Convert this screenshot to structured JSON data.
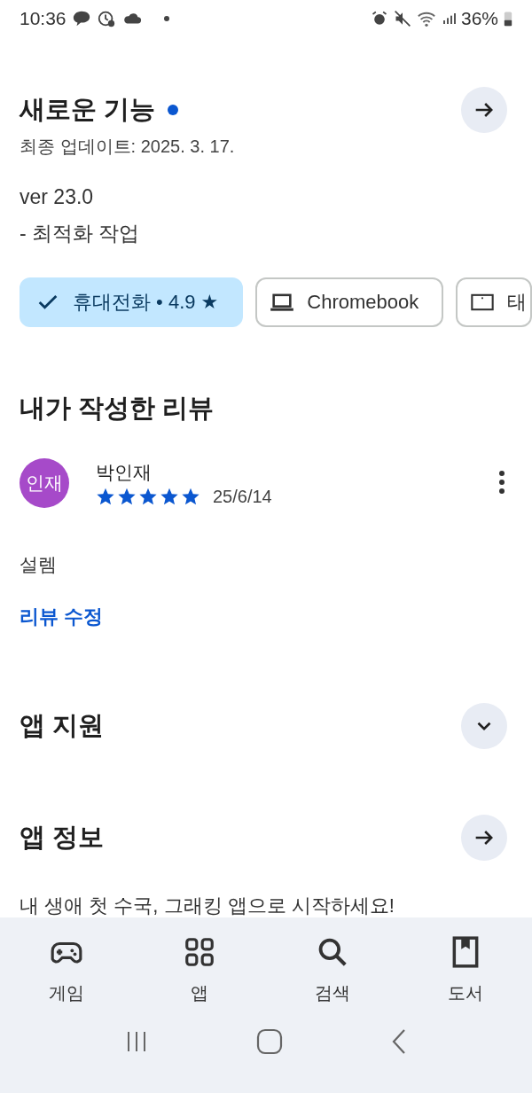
{
  "status_bar": {
    "time": "10:36",
    "battery": "36%"
  },
  "whats_new": {
    "title": "새로운 기능",
    "unread": true,
    "updated": "최종 업데이트: 2025. 3. 17.",
    "notes": [
      "ver 23.0",
      "- 최적화 작업"
    ]
  },
  "device_chips": [
    {
      "label": "휴대전화 • 4.9 ★",
      "selected": true
    },
    {
      "label": "Chromebook",
      "kind": "laptop",
      "selected": false
    },
    {
      "label": "태",
      "kind": "tablet",
      "selected": false
    }
  ],
  "my_review": {
    "heading": "내가 작성한 리뷰",
    "avatar": "인재",
    "author": "박인재",
    "stars": 5,
    "date": "25/6/14",
    "text": "설렘",
    "edit_link": "리뷰 수정"
  },
  "app_support": {
    "title": "앱 지원",
    "expanded": false
  },
  "app_info": {
    "title": "앱 정보",
    "description": "내 생애 첫 수국, 그래킹 앱으로 시작하세요!"
  },
  "bottom_nav": [
    {
      "label": "게임",
      "kind": "games",
      "selected": false
    },
    {
      "label": "앱",
      "kind": "apps",
      "selected": false
    },
    {
      "label": "검색",
      "kind": "search",
      "selected": false
    },
    {
      "label": "도서",
      "kind": "books",
      "selected": false
    }
  ]
}
